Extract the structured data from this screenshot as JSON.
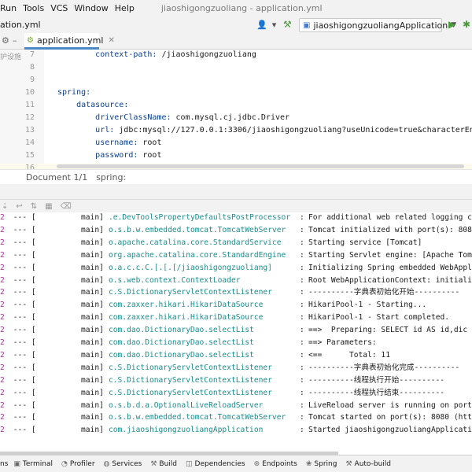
{
  "menubar": {
    "items": [
      "Run",
      "Tools",
      "VCS",
      "Window",
      "Help"
    ],
    "window_title": "jiaoshigongzuoliang - application.yml"
  },
  "toolbar": {
    "breadcrumb": "ation.yml",
    "run_config": "jiaoshigongzuoliangApplication"
  },
  "tabs": {
    "active": "application.yml",
    "side_cut": "护设施"
  },
  "editor": {
    "lines": [
      {
        "num": "7",
        "indent": "        ",
        "key": "context-path",
        "value": " /jiaoshigongzuoliang"
      },
      {
        "num": "8",
        "indent": "",
        "key": "",
        "value": ""
      },
      {
        "num": "9",
        "indent": "",
        "key": "",
        "value": ""
      },
      {
        "num": "10",
        "indent": "",
        "key": "spring",
        "value": ""
      },
      {
        "num": "11",
        "indent": "    ",
        "key": "datasource",
        "value": ""
      },
      {
        "num": "12",
        "indent": "        ",
        "key": "driverClassName",
        "value": " com.mysql.cj.jdbc.Driver"
      },
      {
        "num": "13",
        "indent": "        ",
        "key": "url",
        "value": " jdbc:mysql://127.0.0.1:3306/jiaoshigongzuoliang?useUnicode=true&characterEnc"
      },
      {
        "num": "14",
        "indent": "        ",
        "key": "username",
        "value": " root"
      },
      {
        "num": "15",
        "indent": "        ",
        "key": "password",
        "value": " root"
      },
      {
        "num": "16",
        "indent": "",
        "key": "",
        "value": ""
      }
    ]
  },
  "statusline": {
    "doc": "Document 1/1",
    "path": "spring:"
  },
  "console": {
    "rows": [
      {
        "lead": "2",
        "dash": " --- [",
        "thread": "main]",
        "logger": ".e.DevToolsPropertyDefaultsPostProcessor",
        "msg": "For additional web related logging c"
      },
      {
        "lead": "2",
        "dash": " --- [",
        "thread": "main]",
        "logger": "o.s.b.w.embedded.tomcat.TomcatWebServer",
        "msg": "Tomcat initialized with port(s): 808"
      },
      {
        "lead": "2",
        "dash": " --- [",
        "thread": "main]",
        "logger": "o.apache.catalina.core.StandardService",
        "msg": "Starting service [Tomcat]"
      },
      {
        "lead": "2",
        "dash": " --- [",
        "thread": "main]",
        "logger": "org.apache.catalina.core.StandardEngine",
        "msg": "Starting Servlet engine: [Apache Tom"
      },
      {
        "lead": "2",
        "dash": " --- [",
        "thread": "main]",
        "logger": "o.a.c.c.C.[.[.[/jiaoshigongzuoliang]",
        "msg": "Initializing Spring embedded WebAppl"
      },
      {
        "lead": "2",
        "dash": " --- [",
        "thread": "main]",
        "logger": "o.s.web.context.ContextLoader",
        "msg": "Root WebApplicationContext: initiali"
      },
      {
        "lead": "2",
        "dash": " --- [",
        "thread": "main]",
        "logger": "c.S.DictionaryServletContextListener",
        "msg": "----------字典表初始化开始----------"
      },
      {
        "lead": "2",
        "dash": " --- [",
        "thread": "main]",
        "logger": "com.zaxxer.hikari.HikariDataSource",
        "msg": "HikariPool-1 - Starting..."
      },
      {
        "lead": "2",
        "dash": " --- [",
        "thread": "main]",
        "logger": "com.zaxxer.hikari.HikariDataSource",
        "msg": "HikariPool-1 - Start completed."
      },
      {
        "lead": "2",
        "dash": " --- [",
        "thread": "main]",
        "logger": "com.dao.DictionaryDao.selectList",
        "msg": "==>  Preparing: SELECT id AS id,dic"
      },
      {
        "lead": "2",
        "dash": " --- [",
        "thread": "main]",
        "logger": "com.dao.DictionaryDao.selectList",
        "msg": "==> Parameters:"
      },
      {
        "lead": "2",
        "dash": " --- [",
        "thread": "main]",
        "logger": "com.dao.DictionaryDao.selectList",
        "msg": "<==      Total: 11"
      },
      {
        "lead": "2",
        "dash": " --- [",
        "thread": "main]",
        "logger": "c.S.DictionaryServletContextListener",
        "msg": "----------字典表初始化完成----------"
      },
      {
        "lead": "2",
        "dash": " --- [",
        "thread": "main]",
        "logger": "c.S.DictionaryServletContextListener",
        "msg": "----------线程执行开始----------"
      },
      {
        "lead": "2",
        "dash": " --- [",
        "thread": "main]",
        "logger": "c.S.DictionaryServletContextListener",
        "msg": "----------线程执行结束----------"
      },
      {
        "lead": "2",
        "dash": " --- [",
        "thread": "main]",
        "logger": "o.s.b.d.a.OptionalLiveReloadServer",
        "msg": "LiveReload server is running on port"
      },
      {
        "lead": "2",
        "dash": " --- [",
        "thread": "main]",
        "logger": "o.s.b.w.embedded.tomcat.TomcatWebServer",
        "msg": "Tomcat started on port(s): 8080 (htt"
      },
      {
        "lead": "2",
        "dash": " --- [",
        "thread": "main]",
        "logger": "com.jiaoshigongzuoliangApplication",
        "msg": "Started jiaoshigongzuoliangApplicati"
      }
    ]
  },
  "bottombar": {
    "items": [
      {
        "label": "ns",
        "icon": "none"
      },
      {
        "label": "Terminal",
        "icon": "terminal-icon"
      },
      {
        "label": "Profiler",
        "icon": "profiler-icon"
      },
      {
        "label": "Services",
        "icon": "services-icon"
      },
      {
        "label": "Build",
        "icon": "build-icon"
      },
      {
        "label": "Dependencies",
        "icon": "dependencies-icon"
      },
      {
        "label": "Endpoints",
        "icon": "endpoints-icon"
      },
      {
        "label": "Spring",
        "icon": "spring-icon"
      },
      {
        "label": "Auto-build",
        "icon": "auto-build-icon"
      }
    ]
  }
}
